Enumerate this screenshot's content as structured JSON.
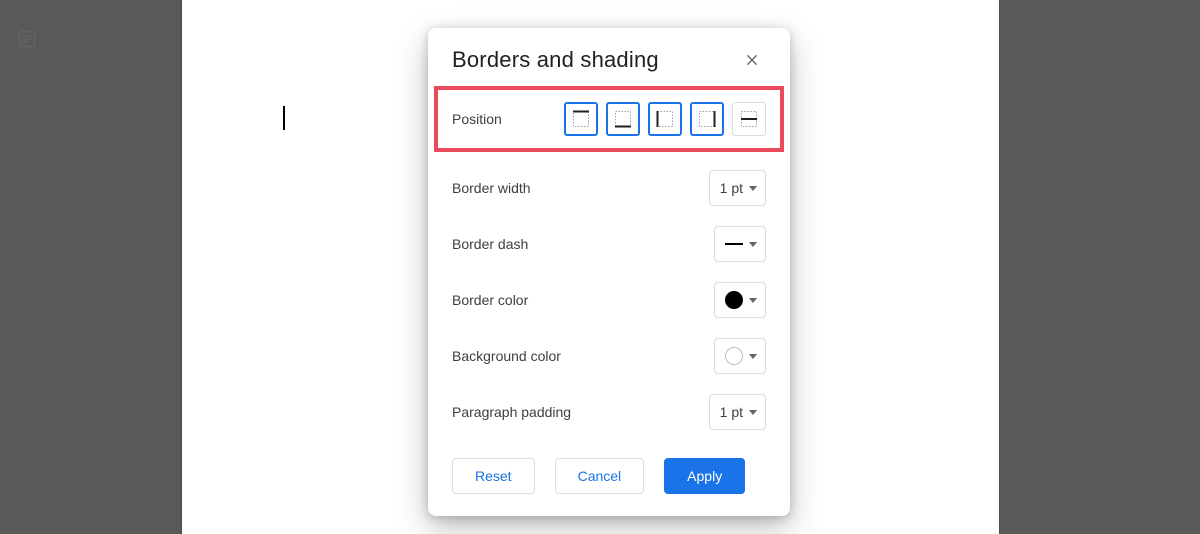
{
  "outline_icon": "list-outline-icon",
  "dialog": {
    "title": "Borders and shading",
    "labels": {
      "position": "Position",
      "border_width": "Border width",
      "border_dash": "Border dash",
      "border_color": "Border color",
      "background_color": "Background color",
      "paragraph_padding": "Paragraph padding"
    },
    "values": {
      "border_width": "1 pt",
      "paragraph_padding": "1 pt"
    },
    "position_options": [
      {
        "name": "border-top",
        "selected": true
      },
      {
        "name": "border-bottom",
        "selected": true
      },
      {
        "name": "border-left",
        "selected": true
      },
      {
        "name": "border-right",
        "selected": true
      },
      {
        "name": "border-between",
        "selected": false
      }
    ],
    "buttons": {
      "reset": "Reset",
      "cancel": "Cancel",
      "apply": "Apply"
    },
    "colors": {
      "border_color": "#000000",
      "background_color": "none"
    }
  }
}
